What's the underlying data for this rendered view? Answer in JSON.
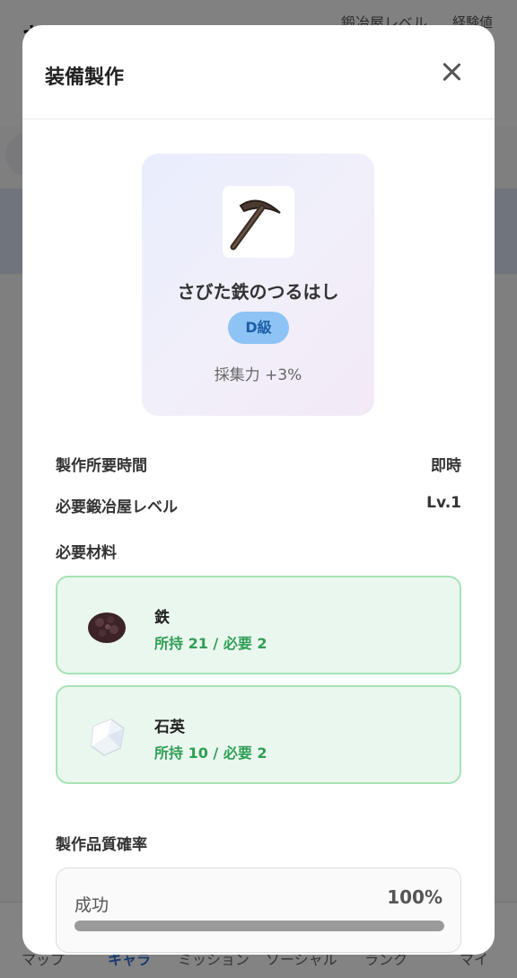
{
  "background": {
    "title": "キャラ",
    "level_label": "鍛冶屋レベル",
    "exp_label": "経験値",
    "nav": [
      {
        "label": "マップ",
        "active": false
      },
      {
        "label": "キャラ",
        "active": true
      },
      {
        "label": "ミッション",
        "active": false
      },
      {
        "label": "ソーシャル",
        "active": false
      },
      {
        "label": "ランク",
        "active": false
      },
      {
        "label": "マイ",
        "active": false
      }
    ]
  },
  "modal": {
    "title": "装備製作",
    "item": {
      "name": "さびた鉄のつるはし",
      "grade": "D級",
      "effect": "採集力 +3%",
      "icon": "pickaxe-icon"
    },
    "craft_time_label": "製作所要時間",
    "craft_time_value": "即時",
    "required_level_label": "必要鍛冶屋レベル",
    "required_level_value": "Lv.1",
    "materials_label": "必要材料",
    "materials": [
      {
        "name": "鉄",
        "count": "所持 21 / 必要 2",
        "icon": "iron-ore-icon"
      },
      {
        "name": "石英",
        "count": "所持 10 / 必要 2",
        "icon": "quartz-icon"
      }
    ],
    "quality_label": "製作品質確率",
    "quality": {
      "label": "成功",
      "value": "100%",
      "percent": 100
    },
    "colors": {
      "accent_green": "#2f9e54",
      "grade_blue": "#8ec4f5"
    }
  }
}
